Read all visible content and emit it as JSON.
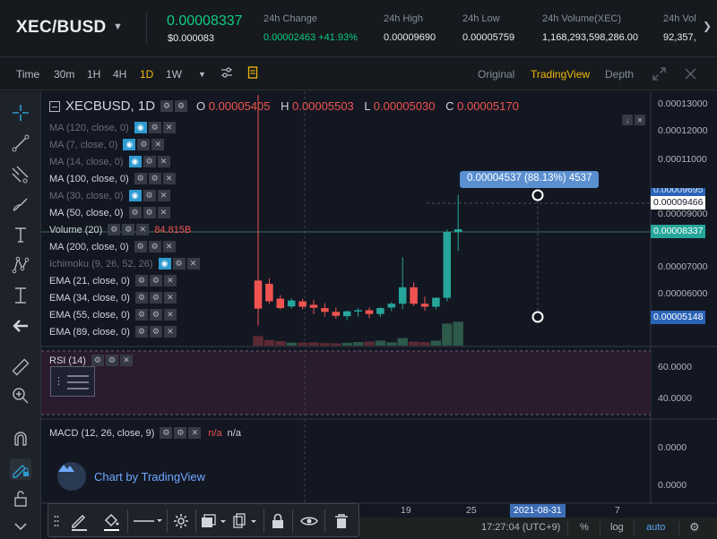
{
  "ticker": {
    "pair": "XEC/BUSD",
    "last_price": "0.00008337",
    "last_price_usd": "$0.000083",
    "stats": [
      {
        "label": "24h Change",
        "value": "0.00002463 +41.93%",
        "color": "green"
      },
      {
        "label": "24h High",
        "value": "0.00009690"
      },
      {
        "label": "24h Low",
        "value": "0.00005759"
      },
      {
        "label": "24h Volume(XEC)",
        "value": "1,168,293,598,286.00"
      },
      {
        "label": "24h Vol",
        "value": "92,357,"
      }
    ]
  },
  "timeframes": {
    "items": [
      "Time",
      "30m",
      "1H",
      "4H",
      "1D",
      "1W"
    ],
    "active": "1D"
  },
  "views": {
    "items": [
      "Original",
      "TradingView",
      "Depth"
    ],
    "active": "TradingView"
  },
  "chart": {
    "symbol": "XECBUSD, 1D",
    "ohlc": {
      "o_label": "O",
      "o": "0.00005405",
      "h_label": "H",
      "h": "0.00005503",
      "l_label": "L",
      "l": "0.00005030",
      "c_label": "C",
      "c": "0.00005170"
    },
    "indicators": [
      {
        "name": "MA (120, close, 0)",
        "dim": true,
        "eye": true
      },
      {
        "name": "MA (7, close, 0)",
        "dim": true,
        "eye": true
      },
      {
        "name": "MA (14, close, 0)",
        "dim": true,
        "eye": true
      },
      {
        "name": "MA (100, close, 0)",
        "dim": false,
        "eye": false
      },
      {
        "name": "MA (30, close, 0)",
        "dim": true,
        "eye": true
      },
      {
        "name": "MA (50, close, 0)",
        "dim": false,
        "eye": false
      },
      {
        "name": "Volume (20)",
        "dim": false,
        "eye": false,
        "value": "84.815B"
      },
      {
        "name": "MA (200, close, 0)",
        "dim": false,
        "eye": false
      },
      {
        "name": "Ichimoku (9, 26, 52, 26)",
        "dim": true,
        "eye": true
      },
      {
        "name": "EMA (21, close, 0)",
        "dim": false,
        "eye": false
      },
      {
        "name": "EMA (34, close, 0)",
        "dim": false,
        "eye": false
      },
      {
        "name": "EMA (55, close, 0)",
        "dim": false,
        "eye": false
      },
      {
        "name": "EMA (89, close, 0)",
        "dim": false,
        "eye": false
      }
    ],
    "price_axis": [
      "0.00013000",
      "0.00012000",
      "0.00011000",
      "0.00009000",
      "0.00007000",
      "0.00006000"
    ],
    "price_tags": {
      "top_hidden": "0.00009695",
      "high": "0.00009466",
      "current": "0.00008337",
      "low": "0.00005148"
    },
    "measure_label": "0.00004537 (88.13%) 4537",
    "rsi": {
      "name": "RSI (14)",
      "axis": [
        "60.0000",
        "40.0000"
      ]
    },
    "macd": {
      "name": "MACD (12, 26, close, 9)",
      "na1": "n/a",
      "na2": "n/a",
      "axis": [
        "0.0000",
        "0.0000"
      ]
    },
    "date_axis": [
      "19",
      "25",
      "2021-08-31",
      "7"
    ],
    "brand": "Chart by TradingView",
    "candles": [
      {
        "o": 6.52e-05,
        "h": 0.000134,
        "l": 4.85e-05,
        "c": 5.48e-05
      },
      {
        "o": 6.4e-05,
        "h": 6.6e-05,
        "l": 5.65e-05,
        "c": 5.75e-05
      },
      {
        "o": 5.85e-05,
        "h": 5.98e-05,
        "l": 5.45e-05,
        "c": 5.5e-05
      },
      {
        "o": 5.56e-05,
        "h": 5.86e-05,
        "l": 5.48e-05,
        "c": 5.78e-05
      },
      {
        "o": 5.75e-05,
        "h": 5.85e-05,
        "l": 5.45e-05,
        "c": 5.55e-05
      },
      {
        "o": 5.62e-05,
        "h": 5.8e-05,
        "l": 5.28e-05,
        "c": 5.51e-05
      },
      {
        "o": 5.5e-05,
        "h": 5.68e-05,
        "l": 5.18e-05,
        "c": 5.36e-05
      },
      {
        "o": 5.36e-05,
        "h": 5.52e-05,
        "l": 5.1e-05,
        "c": 5.21e-05
      },
      {
        "o": 5.2e-05,
        "h": 5.4e-05,
        "l": 5.05e-05,
        "c": 5.38e-05
      },
      {
        "o": 5.38e-05,
        "h": 5.5e-05,
        "l": 5.18e-05,
        "c": 5.42e-05
      },
      {
        "o": 5.42e-05,
        "h": 5.52e-05,
        "l": 5.12e-05,
        "c": 5.28e-05
      },
      {
        "o": 5.28e-05,
        "h": 5.53e-05,
        "l": 5.17e-05,
        "c": 5.5e-05
      },
      {
        "o": 5.52e-05,
        "h": 5.72e-05,
        "l": 5.38e-05,
        "c": 5.66e-05
      },
      {
        "o": 5.66e-05,
        "h": 7.38e-05,
        "l": 5.46e-05,
        "c": 6.27e-05
      },
      {
        "o": 6.27e-05,
        "h": 6.45e-05,
        "l": 5.58e-05,
        "c": 5.66e-05
      },
      {
        "o": 5.66e-05,
        "h": 5.92e-05,
        "l": 5.4e-05,
        "c": 5.55e-05
      },
      {
        "o": 5.55e-05,
        "h": 5.9e-05,
        "l": 5.45e-05,
        "c": 5.88e-05
      },
      {
        "o": 5.88e-05,
        "h": 8.42e-05,
        "l": 5.75e-05,
        "c": 8.32e-05
      },
      {
        "o": 8.32e-05,
        "h": 9.69e-05,
        "l": 7.61e-05,
        "c": 8.42e-05
      }
    ],
    "volumes": [
      0.38,
      0.22,
      0.18,
      0.12,
      0.12,
      0.13,
      0.1,
      0.09,
      0.11,
      0.14,
      0.16,
      0.2,
      0.13,
      0.3,
      0.16,
      0.14,
      0.2,
      0.88,
      0.95
    ]
  },
  "bottom": {
    "clock": "17:27:04 (UTC+9)",
    "percent": "%",
    "log": "log",
    "auto": "auto"
  },
  "colors": {
    "up": "#26a69a",
    "down": "#ef5350",
    "accent": "#f0b90b",
    "blue": "#5ba3f0",
    "green": "#0ecb81"
  },
  "icons": {
    "left_tools": [
      "crosshair-icon",
      "trend-line-icon",
      "fib-tool-icon",
      "brush-icon",
      "text-icon",
      "pattern-icon",
      "measure-icon",
      "back-arrow-icon",
      "ruler-icon",
      "zoom-in-icon",
      "magnet-icon",
      "lock-pencil-icon",
      "unlock-icon",
      "chevron-down-icon"
    ],
    "float_toolbar": [
      "grip-icon",
      "pencil-icon",
      "fill-bucket-icon",
      "line-style-icon",
      "gear-icon",
      "layers-icon",
      "clone-icon",
      "lock-icon",
      "eye-icon",
      "trash-icon"
    ]
  }
}
